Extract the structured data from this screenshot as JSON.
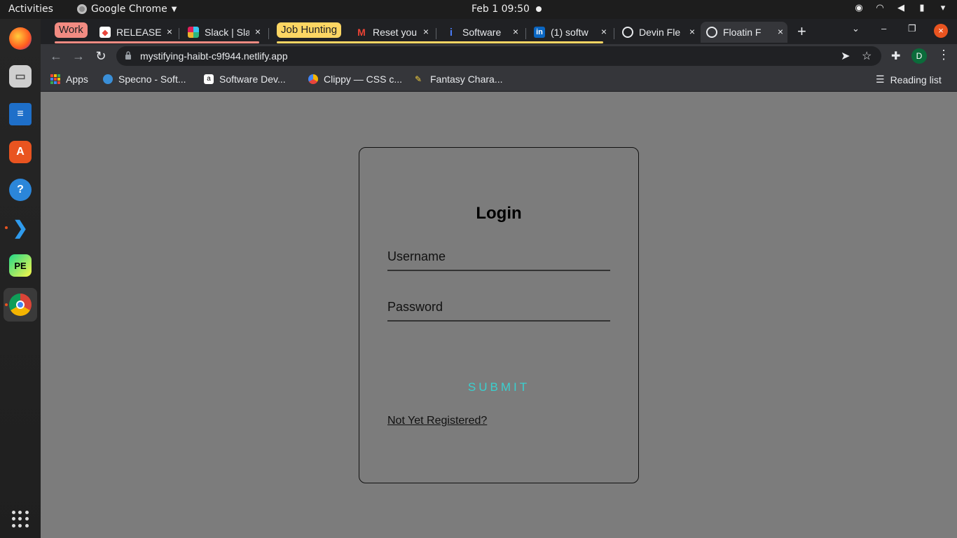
{
  "topbar": {
    "activities": "Activities",
    "app_name": "Google Chrome",
    "clock": "Feb 1  09:50"
  },
  "tabs": [
    {
      "label": "Work",
      "type": "group",
      "color": "#f28b82"
    },
    {
      "label": "RELEASE",
      "close": "×"
    },
    {
      "label": "Slack | Sla",
      "close": "×"
    },
    {
      "label": "Job Hunting",
      "type": "group",
      "color": "#fdd663"
    },
    {
      "label": "Reset you",
      "close": "×"
    },
    {
      "label": "Software",
      "close": "×"
    },
    {
      "label": "(1) softw",
      "close": "×"
    },
    {
      "label": "Devin Fle",
      "close": "×"
    },
    {
      "label": "Floatin F",
      "close": "×",
      "active": true
    }
  ],
  "toolbar": {
    "url": "mystifying-haibt-c9f944.netlify.app",
    "avatar_initial": "D"
  },
  "bookmarks": [
    {
      "label": "Apps"
    },
    {
      "label": "Specno - Soft..."
    },
    {
      "label": "Software Dev..."
    },
    {
      "label": "Clippy — CSS c..."
    },
    {
      "label": "Fantasy Chara..."
    }
  ],
  "reading_list": "Reading list",
  "login": {
    "title": "Login",
    "username_placeholder": "Username",
    "password_placeholder": "Password",
    "submit_label": "SUBMIT",
    "register_link": "Not Yet Registered?"
  },
  "colors": {
    "accent_submit": "#3ad0cf",
    "page_background": "#7c7c7c",
    "ubuntu_orange": "#e95420"
  }
}
